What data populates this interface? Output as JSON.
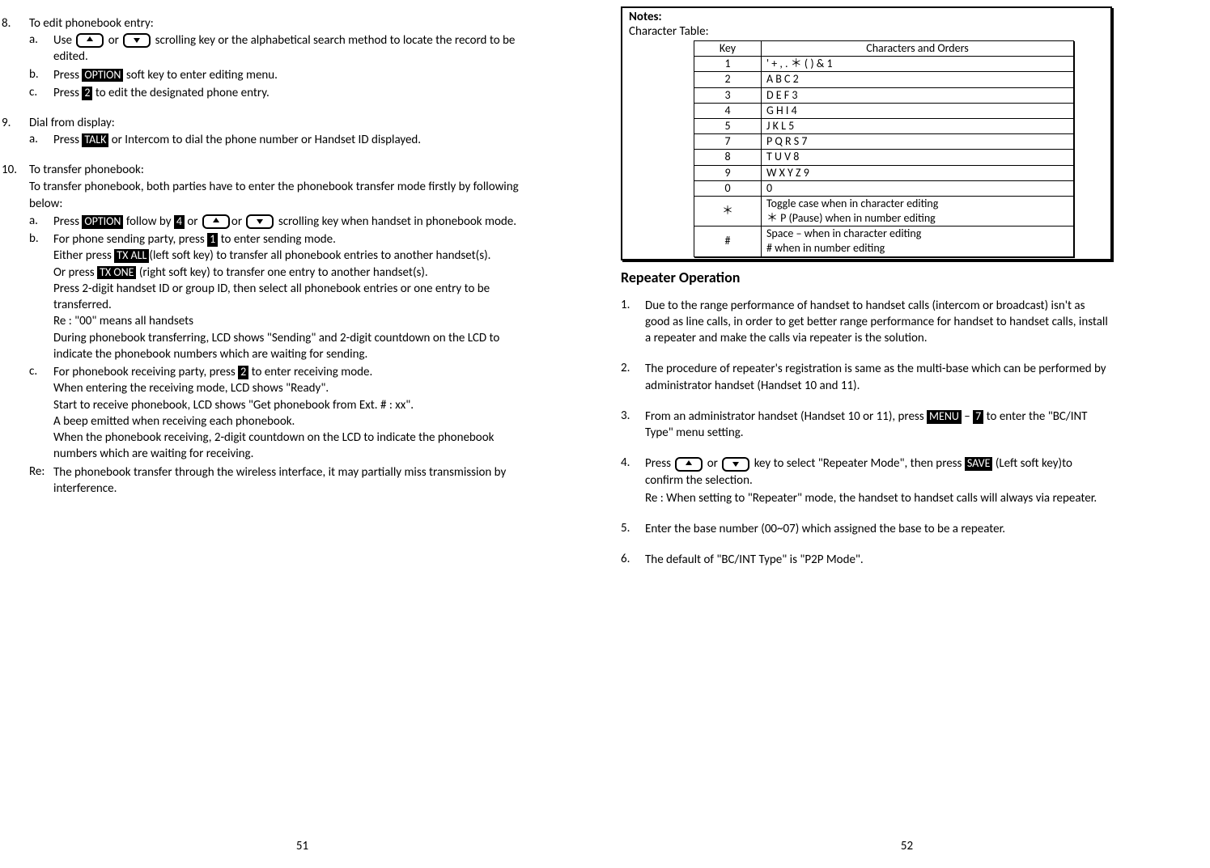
{
  "left": {
    "pageno": "51",
    "i8": {
      "num": "8.",
      "intro": "To edit phonebook entry:",
      "a_lbl": "a.",
      "a1a": "Use ",
      "a1b": " or ",
      "a1c": " scrolling key or the alphabetical search method to locate the record to be edited.",
      "b_lbl": "b.",
      "b1": "Press ",
      "b_key": "OPTION",
      "b2": " soft key to enter editing menu.",
      "c_lbl": "c.",
      "c1": "Press ",
      "c_key": "2",
      "c2": " to edit the designated phone entry."
    },
    "i9": {
      "num": "9.",
      "intro": "Dial from display:",
      "a_lbl": "a.",
      "a1": "Press ",
      "a_key": "TALK",
      "a2": " or Intercom to dial the phone number or Handset ID displayed."
    },
    "i10": {
      "num": "10.",
      "intro": "To transfer phonebook:",
      "desc": "To transfer phonebook, both parties have to enter the phonebook transfer mode firstly by following below:",
      "a_lbl": "a.",
      "a1": "Press ",
      "a_k1": "OPTION",
      "a2": " follow by ",
      "a_k2": "4",
      "a3": " or ",
      "a4": "or ",
      "a5": " scrolling key when handset in phonebook mode.",
      "b_lbl": "b.",
      "b1": "For phone sending party, press ",
      "b_k1": "1",
      "b2": " to enter sending mode.",
      "b3": "Either press ",
      "b_k2": "TX ALL",
      "b4": "(left soft key) to transfer all phonebook entries to another handset(s).",
      "b5": "Or press ",
      "b_k3": "TX ONE",
      "b6": " (right soft key) to transfer one entry to another handset(s).",
      "b7": "Press 2-digit handset ID or group ID, then select all phonebook entries or one entry to be transferred.",
      "b8": "Re : \"00\" means all handsets",
      "b9": "During phonebook transferring, LCD shows \"Sending\" and 2-digit countdown on the LCD to indicate the phonebook numbers which are waiting for sending.",
      "c_lbl": "c.",
      "c1": "For phonebook receiving party, press ",
      "c_k1": "2",
      "c2": " to enter receiving mode.",
      "c3": "When entering the receiving mode, LCD shows \"Ready\".",
      "c4": "Start to receive phonebook, LCD shows \"Get phonebook from Ext. # : xx\".",
      "c5": "A beep emitted when receiving each phonebook.",
      "c6": "When the phonebook receiving, 2-digit countdown on the LCD to indicate the phonebook numbers which are waiting for receiving.",
      "re_lbl": "Re:",
      "re": "The phonebook transfer through the wireless interface, it may partially miss transmission by interference."
    }
  },
  "right": {
    "pageno": "52",
    "notes_hdr": "Notes:",
    "notes_sub": "Character Table:",
    "table": {
      "h1": "Key",
      "h2": "Characters and Orders",
      "rows": [
        {
          "k": "1",
          "v": "' + , . ＊ ( ) & 1"
        },
        {
          "k": "2",
          "v": "A B C 2"
        },
        {
          "k": "3",
          "v": "D E F 3"
        },
        {
          "k": "4",
          "v": "G H I 4"
        },
        {
          "k": "5",
          "v": "J K L 5"
        },
        {
          "k": "7",
          "v": "P Q R S 7"
        },
        {
          "k": "8",
          "v": "T U V 8"
        },
        {
          "k": "9",
          "v": "W X Y Z 9"
        },
        {
          "k": "0",
          "v": "0"
        },
        {
          "k": "＊",
          "v": "Toggle case when in character editing\n＊ P (Pause) when in number editing"
        },
        {
          "k": "#",
          "v": "Space – when in character editing\n# when in number editing"
        }
      ]
    },
    "section": "Repeater Operation",
    "r1": {
      "num": "1.",
      "t": "Due to the range performance of handset to handset calls (intercom or broadcast) isn't as good as line calls, in order to get better range performance for handset to handset calls, install a repeater and make the calls via repeater is the solution."
    },
    "r2": {
      "num": "2.",
      "t": "The procedure of repeater's registration is same as the multi-base which can be performed by administrator handset (Handset 10 and 11)."
    },
    "r3": {
      "num": "3.",
      "t1": "From an administrator handset (Handset 10 or 11), press ",
      "k1": "MENU",
      "t2": " – ",
      "k2": "7",
      "t3": " to enter the \"BC/INT Type\" menu setting."
    },
    "r4": {
      "num": "4.",
      "t1": "Press ",
      "t2": " or ",
      "t3": " key to select \"Repeater Mode\", then press ",
      "k1": "SAVE",
      "t4": " (Left soft key)to confirm the selection.",
      "re": "Re : When setting to \"Repeater\" mode, the handset to handset calls will always via repeater."
    },
    "r5": {
      "num": "5.",
      "t": "Enter the base number (00~07) which assigned the base to be a repeater."
    },
    "r6": {
      "num": "6.",
      "t": "The default of \"BC/INT Type\" is \"P2P Mode\"."
    }
  }
}
